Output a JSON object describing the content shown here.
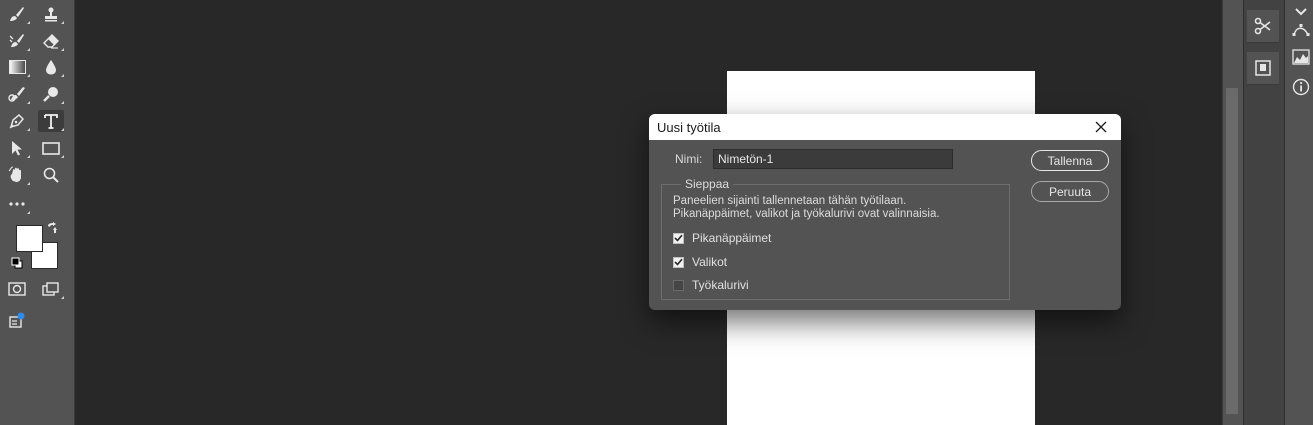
{
  "dialog": {
    "title": "Uusi työtila",
    "name_label": "Nimi:",
    "name_value": "Nimetön-1",
    "capture_legend": "Sieppaa",
    "description_line1": "Paneelien sijainti tallennetaan tähän työtilaan.",
    "description_line2": "Pikanäppäimet, valikot ja työkalurivi ovat valinnaisia.",
    "options": [
      {
        "label": "Pikanäppäimet",
        "checked": true
      },
      {
        "label": "Valikot",
        "checked": true
      },
      {
        "label": "Työkalurivi",
        "checked": false
      }
    ],
    "save_label": "Tallenna",
    "cancel_label": "Peruuta"
  },
  "toolbar": {
    "tools": [
      "brush-icon",
      "stamp-icon",
      "history-brush-icon",
      "eraser-icon",
      "gradient-icon",
      "blur-drop-icon",
      "dodge-icon",
      "zoom-lens-icon",
      "pen-icon",
      "type-icon",
      "selection-arrow-icon",
      "rectangle-icon",
      "hand-icon",
      "magnifier-icon",
      "more-tools-icon"
    ],
    "foreground_color": "#ffffff",
    "background_color": "#ffffff"
  },
  "panels": {
    "icons": [
      "scissors-icon",
      "layer-comps-icon",
      "paths-icon",
      "histogram-icon",
      "info-icon"
    ]
  },
  "colors": {
    "app_bg": "#282828",
    "panel_bg": "#535353",
    "dialog_bg": "#535353",
    "canvas": "#ffffff"
  }
}
